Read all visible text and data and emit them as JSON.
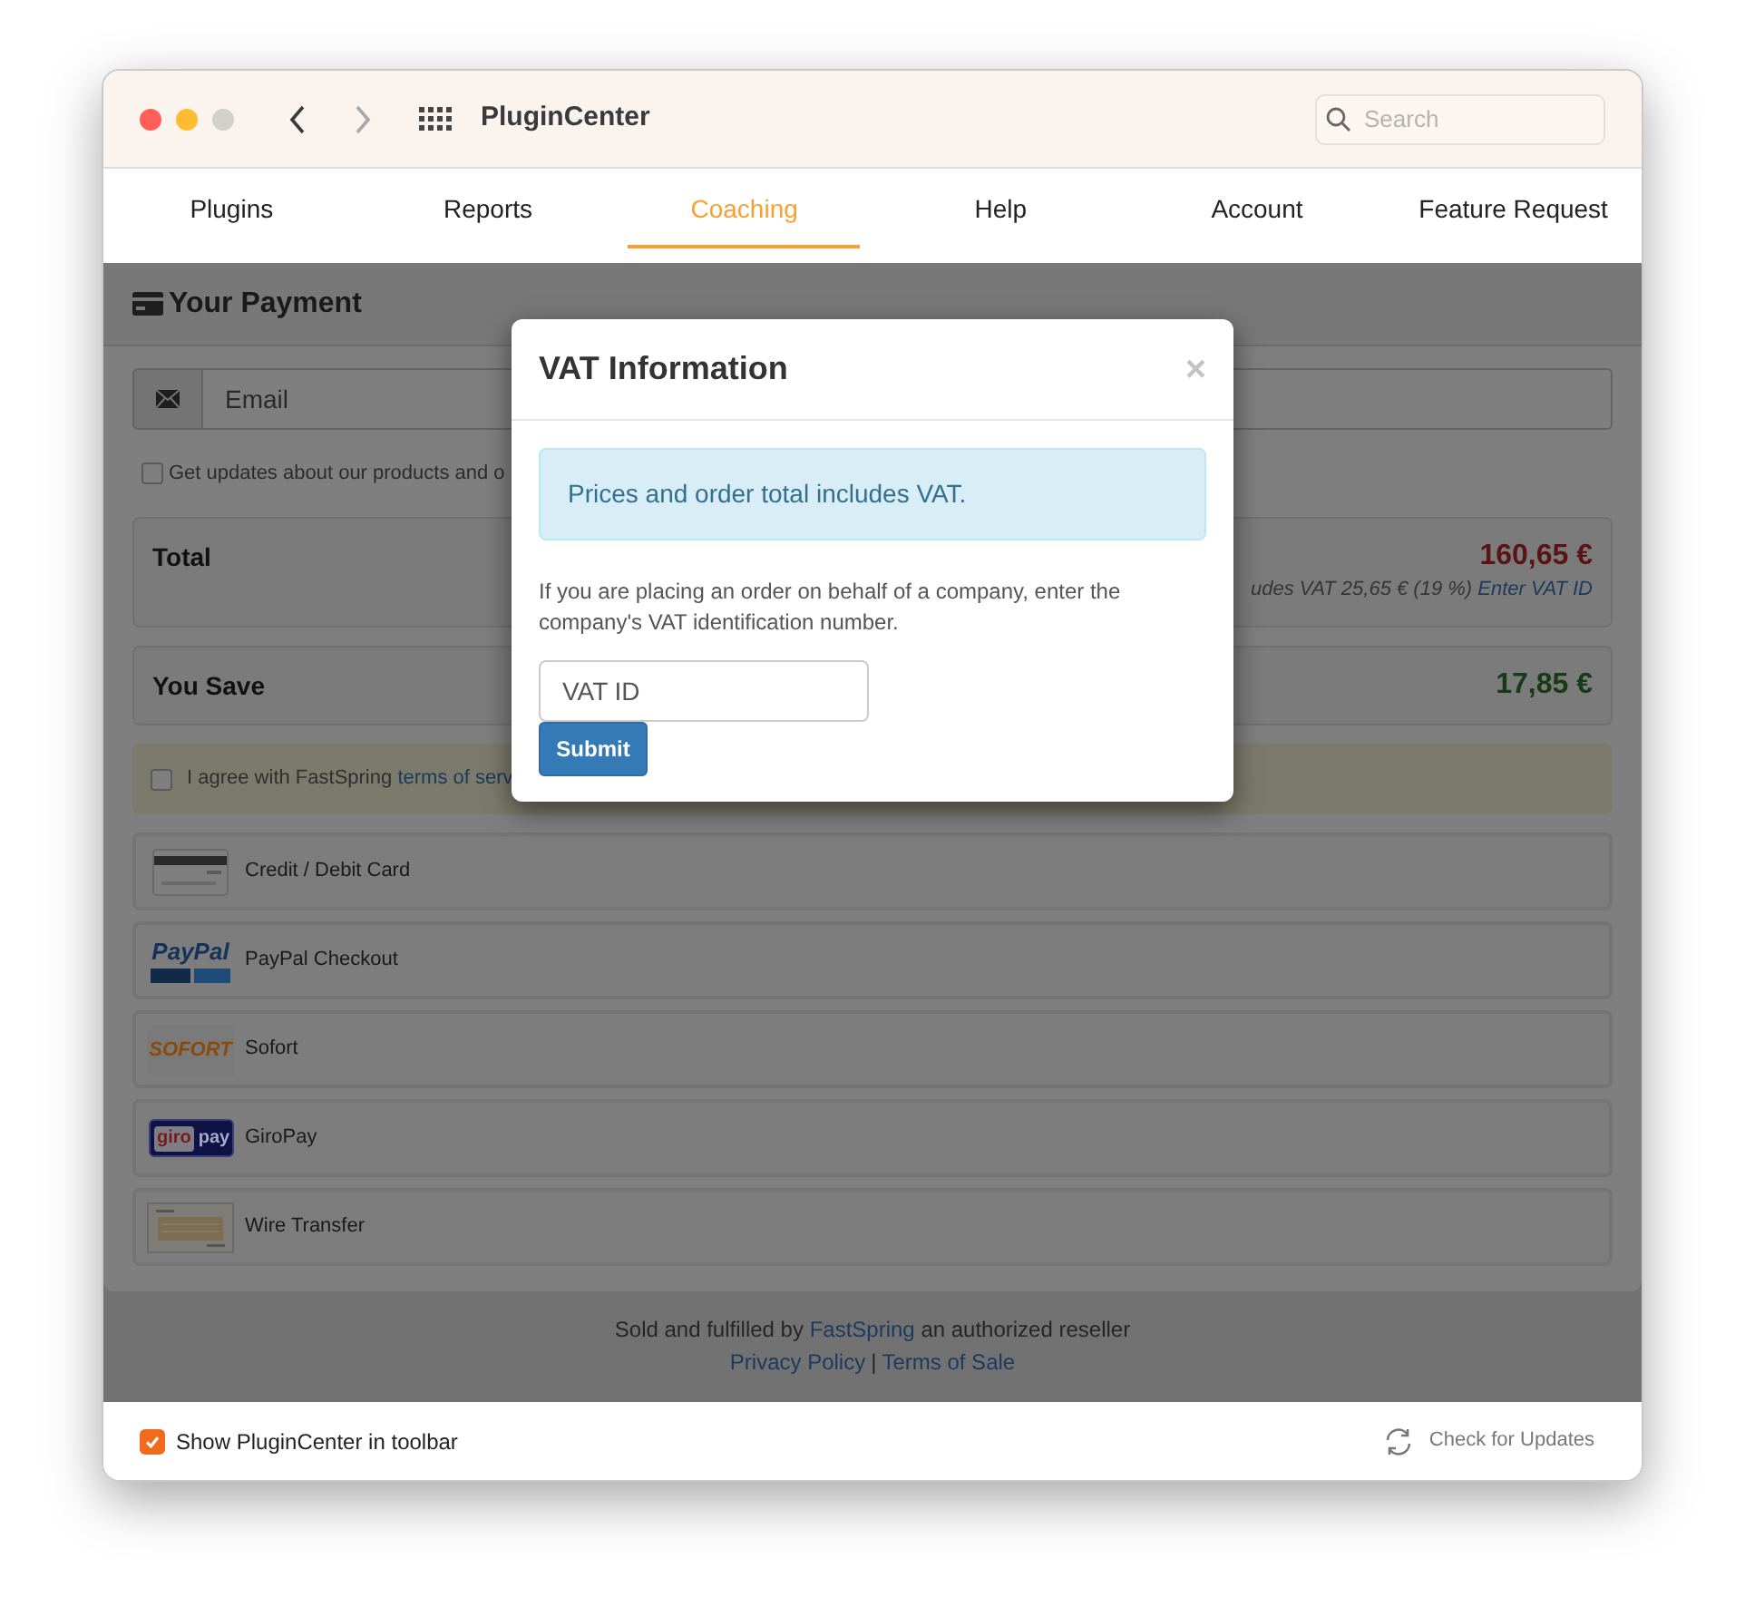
{
  "window": {
    "title": "PluginCenter",
    "search": {
      "placeholder": "Search"
    }
  },
  "tabs": [
    {
      "label": "Plugins",
      "selected": false
    },
    {
      "label": "Reports",
      "selected": false
    },
    {
      "label": "Coaching",
      "selected": true
    },
    {
      "label": "Help",
      "selected": false
    },
    {
      "label": "Account",
      "selected": false
    },
    {
      "label": "Feature Request",
      "selected": false
    }
  ],
  "payment": {
    "title": "Your Payment",
    "email": {
      "placeholder": "Email"
    },
    "updates": {
      "label": "Get updates about our products and o",
      "checked": false
    },
    "total": {
      "label": "Total",
      "amount": "160,65 €",
      "vat_note": "udes VAT 25,65 € (19 %)",
      "vat_link": "Enter VAT ID"
    },
    "savings": {
      "label": "You Save",
      "amount": "17,85 €"
    },
    "terms": {
      "text": "I agree with FastSpring",
      "link": "terms of serv",
      "checked": false
    },
    "methods": [
      {
        "kind": "card",
        "label": "Credit / Debit Card"
      },
      {
        "kind": "paypal",
        "logo_parts": [
          "PayPal"
        ],
        "label": "PayPal Checkout"
      },
      {
        "kind": "sofort",
        "logo_parts": [
          "SOFORT"
        ],
        "label": "Sofort"
      },
      {
        "kind": "giropay",
        "logo_parts": [
          "giro",
          "pay"
        ],
        "label": "GiroPay"
      },
      {
        "kind": "wire",
        "label": "Wire Transfer"
      }
    ]
  },
  "footer": {
    "before": "Sold and fulfilled by",
    "link": "FastSpring",
    "after": "an authorized reseller",
    "links": [
      "Privacy Policy",
      "Terms of Sale"
    ],
    "separator": "|"
  },
  "dialog": {
    "title": "VAT Information",
    "close": "×",
    "alert": "Prices and order total includes VAT.",
    "text": "If you are placing an order on behalf of a company, enter the company's VAT identification number.",
    "field": {
      "placeholder": "VAT ID"
    },
    "submit": "Submit"
  },
  "bottom_bar": {
    "option": {
      "label": "Show PluginCenter in toolbar",
      "checked": true
    },
    "update_button": "Check for Updates"
  }
}
